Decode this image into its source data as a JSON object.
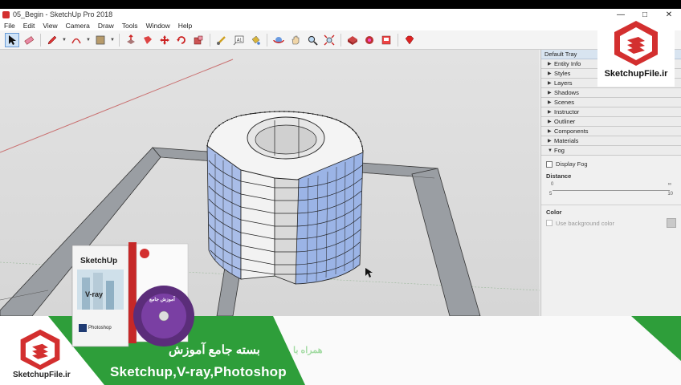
{
  "window": {
    "title": "05_Begin - SketchUp Pro 2018",
    "controls": [
      "—",
      "□",
      "✕"
    ]
  },
  "menu": [
    "File",
    "Edit",
    "View",
    "Camera",
    "Draw",
    "Tools",
    "Window",
    "Help"
  ],
  "toolbar": {
    "tools": [
      "select-tool",
      "eraser-tool",
      "pencil-tool",
      "arc-tool",
      "rectangle-tool",
      "push-pull-tool",
      "follow-me-tool",
      "move-tool",
      "rotate-tool",
      "scale-tool",
      "tape-measure-tool",
      "text-tool",
      "paint-bucket-tool",
      "orbit-tool",
      "pan-tool",
      "zoom-tool",
      "zoom-extents-tool",
      "warehouse-tool",
      "extension-warehouse-tool",
      "layout-tool",
      "ruby-tool"
    ]
  },
  "tray": {
    "title": "Default Tray",
    "panels": [
      "Entity Info",
      "Styles",
      "Layers",
      "Shadows",
      "Scenes",
      "Instructor",
      "Outliner",
      "Components",
      "Materials",
      "Fog"
    ],
    "fog": {
      "display_fog": "Display Fog",
      "distance_label": "Distance",
      "slider_start": "0",
      "slider_end": "∞",
      "slider_sub_start": "5",
      "slider_sub_end": "10",
      "color_label": "Color",
      "use_background": "Use background color"
    }
  },
  "watermark": {
    "brand": "SketchupFile.ir"
  },
  "banner": {
    "title_fa": "بسته جامع آموزش",
    "subtitle_fa": "همراه با",
    "title_en": "Sketchup,V-ray,Photoshop",
    "brand": "SketchupFile.ir"
  },
  "product": {
    "box_title": "SketchUp",
    "box_vray": "V-ray",
    "box_ps": "Photoshop",
    "disc_text": "آموزش جامع"
  },
  "colors": {
    "brand_red": "#d32f2f",
    "banner_green": "#2e9e3a",
    "viewport_bg": "#dcdcdc",
    "glass_blue": "#8faee8"
  }
}
